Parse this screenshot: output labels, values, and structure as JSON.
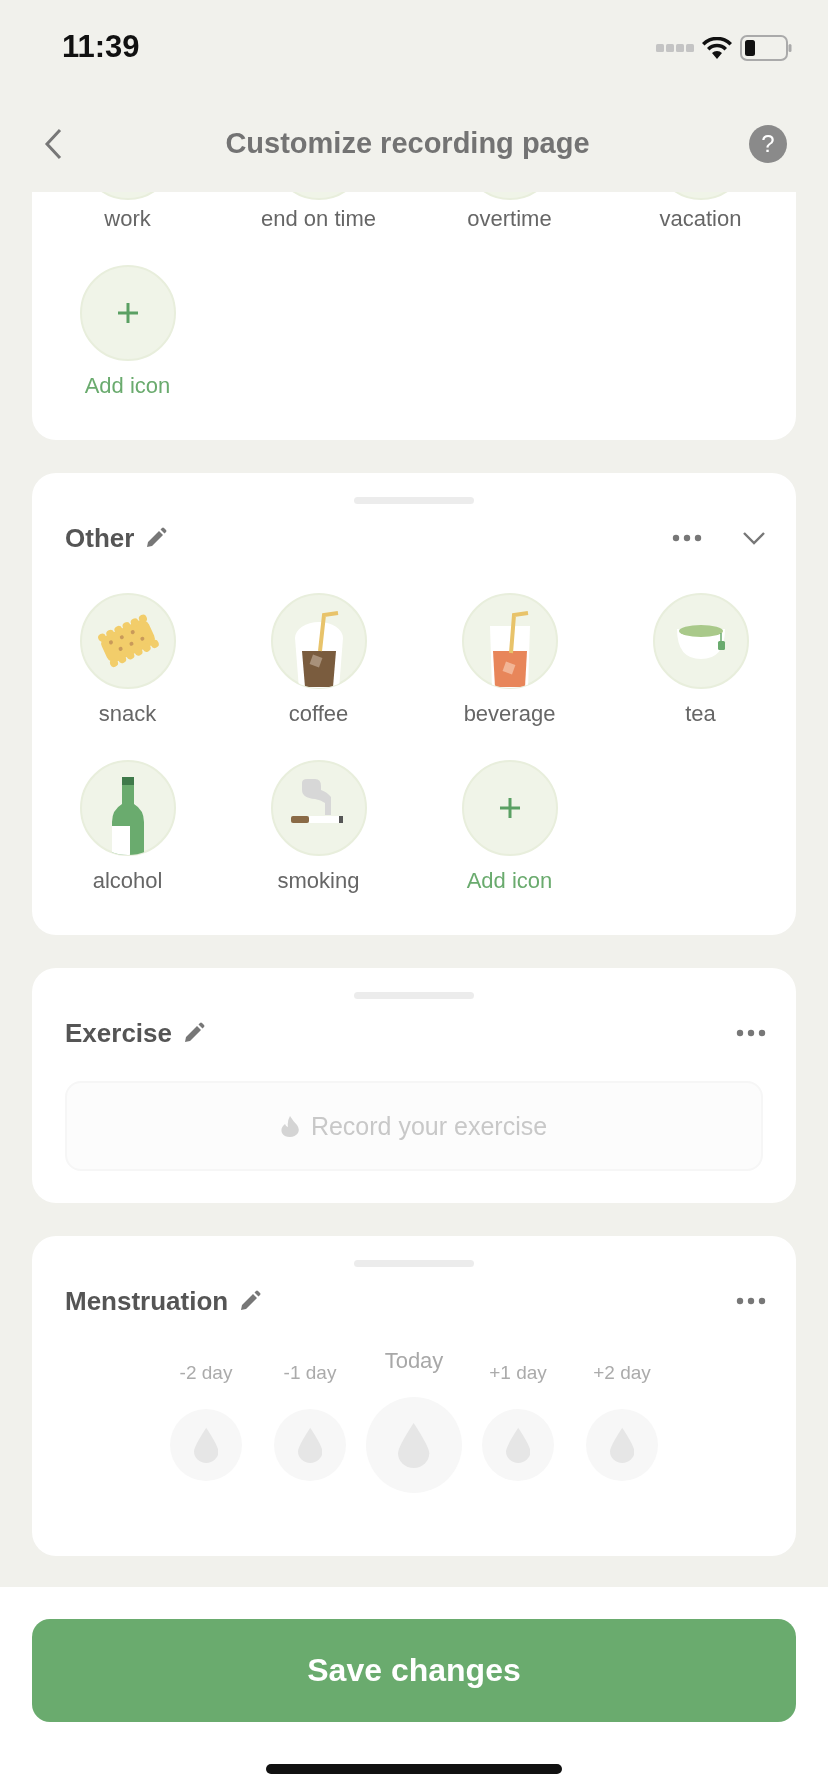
{
  "status_bar": {
    "time": "11:39"
  },
  "nav": {
    "title": "Customize recording page",
    "help_glyph": "?"
  },
  "partial_section": {
    "items": [
      {
        "label": "work"
      },
      {
        "label": "end on time"
      },
      {
        "label": "overtime"
      },
      {
        "label": "vacation"
      }
    ],
    "add_label": "Add icon"
  },
  "sections": [
    {
      "kind": "icons",
      "title": "Other",
      "collapsible": true,
      "items": [
        {
          "label": "snack"
        },
        {
          "label": "coffee"
        },
        {
          "label": "beverage"
        },
        {
          "label": "tea"
        },
        {
          "label": "alcohol"
        },
        {
          "label": "smoking"
        }
      ],
      "add_label": "Add icon"
    },
    {
      "kind": "exercise",
      "title": "Exercise",
      "collapsible": false,
      "placeholder": "Record your exercise"
    },
    {
      "kind": "menstruation",
      "title": "Menstruation",
      "collapsible": false,
      "days": [
        {
          "label": "-2 day",
          "selected": false
        },
        {
          "label": "-1 day",
          "selected": false
        },
        {
          "label": "Today",
          "selected": true
        },
        {
          "label": "+1 day",
          "selected": false
        },
        {
          "label": "+2 day",
          "selected": false
        }
      ]
    }
  ],
  "save_button": "Save changes"
}
